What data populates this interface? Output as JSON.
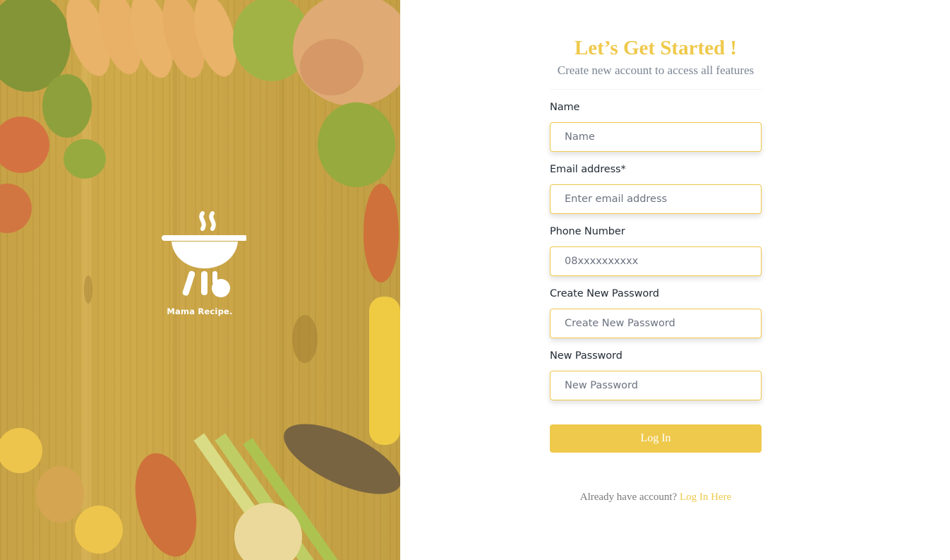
{
  "brand": {
    "logo_icon": "grill-icon",
    "name": "Mama Recipe."
  },
  "header": {
    "title": "Let’s Get Started !",
    "subtitle": "Create new account to access all features"
  },
  "form": {
    "fields": [
      {
        "label": "Name",
        "placeholder": "Name",
        "value": ""
      },
      {
        "label": "Email address*",
        "placeholder": "Enter email address",
        "value": ""
      },
      {
        "label": "Phone Number",
        "placeholder": "08xxxxxxxxxx",
        "value": ""
      },
      {
        "label": "Create New Password",
        "placeholder": "Create New Password",
        "value": ""
      },
      {
        "label": "New Password",
        "placeholder": "New Password",
        "value": ""
      }
    ],
    "submit_label": "Log In"
  },
  "footer": {
    "prompt": "Already have account?",
    "link_label": "Log In Here"
  },
  "colors": {
    "accent": "#efc94c",
    "subtitle": "#7a8593"
  }
}
